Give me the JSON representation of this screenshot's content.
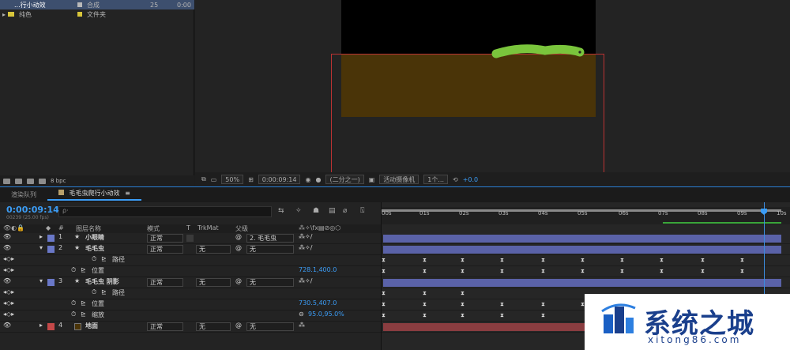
{
  "project": {
    "items": [
      {
        "name": "...行小动效",
        "type": "合成",
        "rate": "25",
        "dur": "0:00",
        "color": "#b9b9b9"
      },
      {
        "name": "纯色",
        "type": "文件夹",
        "color": "#d8c53a"
      }
    ],
    "bpc": "8 bpc"
  },
  "viewer": {
    "zoom": "50%",
    "time": "0:00:09:14",
    "resolution": "(二分之一)",
    "camera": "活动摄像机",
    "views": "1个...",
    "exposure": "+0.0",
    "colors": {
      "stage": "#000000",
      "ground": "#4a3408",
      "caterpillar": "#7ac53c"
    }
  },
  "tabs": [
    {
      "label": "渲染队列"
    },
    {
      "label": "毛毛虫爬行小动效"
    }
  ],
  "timeline": {
    "current_time": "0:00:09:14",
    "frames": "00239 (25.00 fps)",
    "search_placeholder": "ρ·",
    "headers": {
      "name": "图层名称",
      "mode": "模式",
      "t": "T",
      "trkmat": "TrkMat",
      "parent": "父级"
    },
    "ruler": [
      "00s",
      "01s",
      "02s",
      "03s",
      "04s",
      "05s",
      "06s",
      "07s",
      "08s",
      "09s",
      "10s"
    ],
    "layers": [
      {
        "num": "1",
        "name": "小眼睛",
        "mode": "正常",
        "trk": "",
        "parent": "2. 毛毛虫",
        "color": "#6a78c8"
      },
      {
        "num": "2",
        "name": "毛毛虫",
        "mode": "正常",
        "trk": "无",
        "parent": "无",
        "color": "#6a78c8"
      },
      {
        "prop": "路径"
      },
      {
        "prop": "位置",
        "value": "728.1,400.0"
      },
      {
        "num": "3",
        "name": "毛毛虫 阴影",
        "mode": "正常",
        "trk": "无",
        "parent": "无",
        "color": "#6a78c8"
      },
      {
        "prop": "路径"
      },
      {
        "prop": "位置",
        "value": "730.5,407.0"
      },
      {
        "prop": "缩放",
        "value": "95.0,95.0%"
      },
      {
        "num": "4",
        "name": "地面",
        "mode": "正常",
        "trk": "无",
        "parent": "无",
        "color": "#c44848"
      }
    ]
  },
  "watermark": {
    "title": "系统之城",
    "url": "xitong86.com"
  }
}
